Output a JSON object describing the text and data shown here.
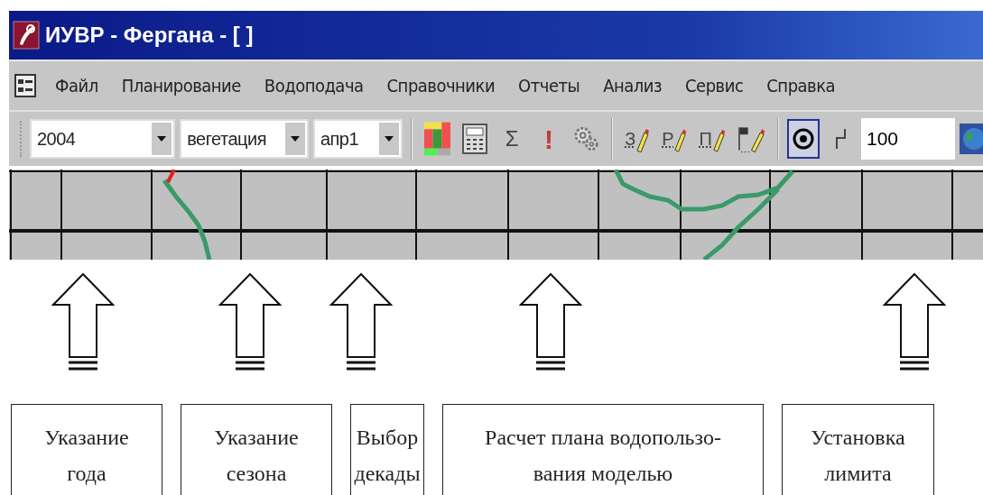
{
  "window": {
    "title": "ИУВР - Фергана - [ ]"
  },
  "menu": [
    "Файл",
    "Планирование",
    "Водоподача",
    "Справочники",
    "Отчеты",
    "Анализ",
    "Сервис",
    "Справка"
  ],
  "toolbar": {
    "dropdowns": [
      {
        "value": "2004"
      },
      {
        "value": "вегетация"
      },
      {
        "value": "апр1"
      }
    ],
    "tool_groups": [
      [
        {
          "kind": "colors",
          "pressed": false
        },
        {
          "kind": "calculator",
          "pressed": false
        },
        {
          "kind": "glyph",
          "label": "Σ",
          "pressed": false
        },
        {
          "kind": "alert",
          "label": "!",
          "pressed": false
        },
        {
          "kind": "gears",
          "pressed": false
        }
      ],
      [
        {
          "kind": "pencil",
          "label": "З",
          "pressed": false
        },
        {
          "kind": "pencil",
          "label": "Р",
          "pressed": false
        },
        {
          "kind": "pencil",
          "label": "П",
          "pressed": false
        },
        {
          "kind": "flag",
          "pressed": false
        }
      ],
      [
        {
          "kind": "target",
          "pressed": true
        },
        {
          "kind": "corner",
          "pressed": false
        },
        {
          "kind": "input",
          "value": "100"
        },
        {
          "kind": "globe",
          "pressed": false
        }
      ]
    ]
  },
  "annotations": [
    {
      "label": "Указание\nгода"
    },
    {
      "label": "Указание\nсезона"
    },
    {
      "label": "Выбор\nдекады"
    },
    {
      "label": "Расчет плана водопользо-\nвания моделью"
    },
    {
      "label": "Установка\nлимита"
    }
  ]
}
